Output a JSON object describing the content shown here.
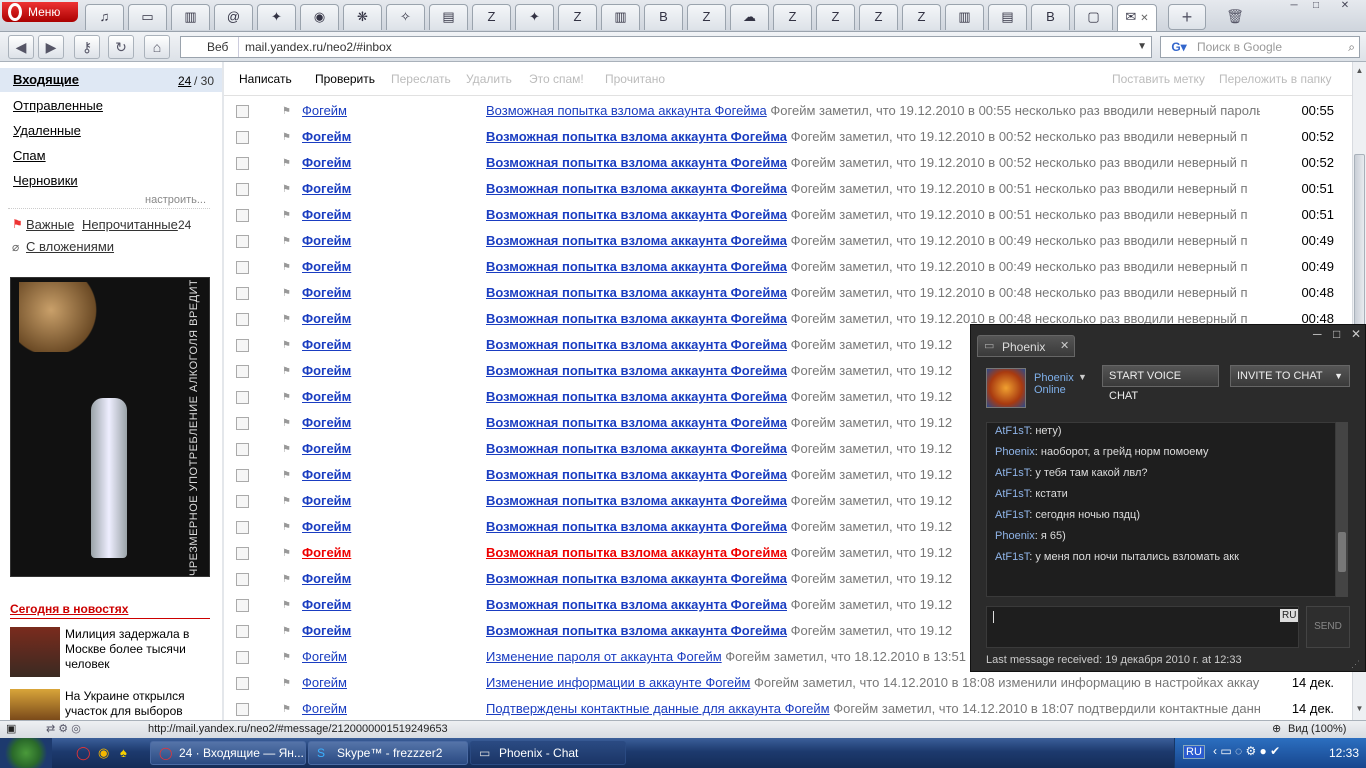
{
  "browser": {
    "menu_label": "Меню",
    "tab_icons": [
      "music-tab",
      "window-tab",
      "book-tab",
      "email-tab",
      "star-tab",
      "monitor-tab",
      "app-tab",
      "sparkle-tab",
      "doc-tab",
      "z-tab",
      "star2-tab",
      "z2-tab",
      "book2-tab",
      "b-tab",
      "z3-tab",
      "skype-tab",
      "z4-tab",
      "z5-tab",
      "z6-tab",
      "z7-tab",
      "book3-tab",
      "doc2-tab",
      "b2-tab",
      "chat-tab",
      "yandex-tab"
    ],
    "tab_glyphs": [
      "♫",
      "▭",
      "▥",
      "@",
      "✦",
      "◉",
      "❋",
      "✧",
      "▤",
      "Z",
      "✦",
      "Z",
      "▥",
      "B",
      "Z",
      "☁",
      "Z",
      "Z",
      "Z",
      "Z",
      "▥",
      "▤",
      "B",
      "▢",
      "✉"
    ],
    "address_prefix": "Веб",
    "address_url": "mail.yandex.ru/neo2/#inbox",
    "search_placeholder": "Поиск в Google"
  },
  "sidebar": {
    "inbox_label": "Входящие",
    "inbox_unread": "24",
    "inbox_total": "/ 30",
    "folders": [
      "Отправленные",
      "Удаленные",
      "Спам",
      "Черновики"
    ],
    "configure": "настроить...",
    "important": "Важные",
    "unread": "Непрочитанные",
    "unread_count": "24",
    "attachments": "С вложениями",
    "ad_text": "ЧРЕЗМЕРНОЕ УПОТРЕБЛЕНИЕ АЛКОГОЛЯ ВРЕДИТ ВАШЕМУ ЗДОРОВЬЮ",
    "news_title": "Сегодня в новостях",
    "news": [
      "Милиция задержала в Москве более тысячи человек",
      "На Украине открылся участок для выборов"
    ]
  },
  "toolbar": {
    "compose": "Написать",
    "check": "Проверить",
    "forward": "Переслать",
    "delete": "Удалить",
    "spam": "Это спам!",
    "read": "Прочитано",
    "label": "Поставить метку",
    "move": "Переложить в папку"
  },
  "emails": [
    {
      "from": "Фогейм",
      "subject": "Возможная попытка взлома аккаунта Фогейма",
      "snippet": "Фогейм заметил, что 19.12.2010 в 00:55 несколько раз вводили неверный пароль",
      "time": "00:55",
      "style": "normal"
    },
    {
      "from": "Фогейм",
      "subject": "Возможная попытка взлома аккаунта Фогейма",
      "snippet": "Фогейм заметил, что 19.12.2010 в 00:52 несколько раз вводили неверный п",
      "time": "00:52",
      "style": "bold"
    },
    {
      "from": "Фогейм",
      "subject": "Возможная попытка взлома аккаунта Фогейма",
      "snippet": "Фогейм заметил, что 19.12.2010 в 00:52 несколько раз вводили неверный п",
      "time": "00:52",
      "style": "bold"
    },
    {
      "from": "Фогейм",
      "subject": "Возможная попытка взлома аккаунта Фогейма",
      "snippet": "Фогейм заметил, что 19.12.2010 в 00:51 несколько раз вводили неверный п",
      "time": "00:51",
      "style": "bold"
    },
    {
      "from": "Фогейм",
      "subject": "Возможная попытка взлома аккаунта Фогейма",
      "snippet": "Фогейм заметил, что 19.12.2010 в 00:51 несколько раз вводили неверный п",
      "time": "00:51",
      "style": "bold"
    },
    {
      "from": "Фогейм",
      "subject": "Возможная попытка взлома аккаунта Фогейма",
      "snippet": "Фогейм заметил, что 19.12.2010 в 00:49 несколько раз вводили неверный п",
      "time": "00:49",
      "style": "bold"
    },
    {
      "from": "Фогейм",
      "subject": "Возможная попытка взлома аккаунта Фогейма",
      "snippet": "Фогейм заметил, что 19.12.2010 в 00:49 несколько раз вводили неверный п",
      "time": "00:49",
      "style": "bold"
    },
    {
      "from": "Фогейм",
      "subject": "Возможная попытка взлома аккаунта Фогейма",
      "snippet": "Фогейм заметил, что 19.12.2010 в 00:48 несколько раз вводили неверный п",
      "time": "00:48",
      "style": "bold"
    },
    {
      "from": "Фогейм",
      "subject": "Возможная попытка взлома аккаунта Фогейма",
      "snippet": "Фогейм заметил, что 19.12.2010 в 00:48 несколько раз вводили неверный п",
      "time": "00:48",
      "style": "bold"
    },
    {
      "from": "Фогейм",
      "subject": "Возможная попытка взлома аккаунта Фогейма",
      "snippet": "Фогейм заметил, что 19.12",
      "time": "",
      "style": "bold"
    },
    {
      "from": "Фогейм",
      "subject": "Возможная попытка взлома аккаунта Фогейма",
      "snippet": "Фогейм заметил, что 19.12",
      "time": "",
      "style": "bold"
    },
    {
      "from": "Фогейм",
      "subject": "Возможная попытка взлома аккаунта Фогейма",
      "snippet": "Фогейм заметил, что 19.12",
      "time": "",
      "style": "bold"
    },
    {
      "from": "Фогейм",
      "subject": "Возможная попытка взлома аккаунта Фогейма",
      "snippet": "Фогейм заметил, что 19.12",
      "time": "",
      "style": "bold"
    },
    {
      "from": "Фогейм",
      "subject": "Возможная попытка взлома аккаунта Фогейма",
      "snippet": "Фогейм заметил, что 19.12",
      "time": "",
      "style": "bold"
    },
    {
      "from": "Фогейм",
      "subject": "Возможная попытка взлома аккаунта Фогейма",
      "snippet": "Фогейм заметил, что 19.12",
      "time": "",
      "style": "bold"
    },
    {
      "from": "Фогейм",
      "subject": "Возможная попытка взлома аккаунта Фогейма",
      "snippet": "Фогейм заметил, что 19.12",
      "time": "",
      "style": "bold"
    },
    {
      "from": "Фогейм",
      "subject": "Возможная попытка взлома аккаунта Фогейма",
      "snippet": "Фогейм заметил, что 19.12",
      "time": "",
      "style": "bold"
    },
    {
      "from": "Фогейм",
      "subject": "Возможная попытка взлома аккаунта Фогейма",
      "snippet": "Фогейм заметил, что 19.12",
      "time": "",
      "style": "red"
    },
    {
      "from": "Фогейм",
      "subject": "Возможная попытка взлома аккаунта Фогейма",
      "snippet": "Фогейм заметил, что 19.12",
      "time": "",
      "style": "bold"
    },
    {
      "from": "Фогейм",
      "subject": "Возможная попытка взлома аккаунта Фогейма",
      "snippet": "Фогейм заметил, что 19.12",
      "time": "",
      "style": "bold"
    },
    {
      "from": "Фогейм",
      "subject": "Возможная попытка взлома аккаунта Фогейма",
      "snippet": "Фогейм заметил, что 19.12",
      "time": "",
      "style": "bold"
    },
    {
      "from": "Фогейм",
      "subject": "Изменение пароля от аккаунта Фогейм",
      "snippet": "Фогейм заметил, что 18.12.2010 в 13:51",
      "time": "",
      "style": "normal"
    },
    {
      "from": "Фогейм",
      "subject": "Изменение информации в аккаунте Фогейм",
      "snippet": "Фогейм заметил, что 14.12.2010 в 18:08 изменили информацию в настройках аккаун",
      "time": "14 дек.",
      "style": "normal"
    },
    {
      "from": "Фогейм",
      "subject": "Подтверждены контактные данные для аккаунта Фогейм",
      "snippet": "Фогейм заметил, что 14.12.2010 в 18:07 подтвердили контактные данн",
      "time": "14 дек.",
      "style": "normal"
    }
  ],
  "status": {
    "url": "http://mail.yandex.ru/neo2/#message/2120000001519249653",
    "zoom": "Вид (100%)"
  },
  "chat": {
    "title": "Phoenix",
    "user": "Phoenix",
    "presence": "Online",
    "voice": "START VOICE CHAT",
    "invite": "INVITE TO CHAT",
    "messages": [
      {
        "who": "AtF1sT",
        "text": ": нету)"
      },
      {
        "who": "Phoenix",
        "text": ": наоборот, а грейд норм помоему"
      },
      {
        "who": "AtF1sT",
        "text": ": у тебя там какой лвл?"
      },
      {
        "who": "AtF1sT",
        "text": ": кстати"
      },
      {
        "who": "AtF1sT",
        "text": ": сегодня ночью пздц)"
      },
      {
        "who": "Phoenix",
        "text": ": я 65)"
      },
      {
        "who": "AtF1sT",
        "text": ": у меня пол ночи пытались взломать акк"
      }
    ],
    "lang": "RU",
    "send": "SEND",
    "last": "Last message received: 19 декабря 2010 г. at 12:33"
  },
  "taskbar": {
    "items": [
      "24 · Входящие — Ян...",
      "Skype™ - frezzzer2",
      "Phoenix - Chat"
    ],
    "lang": "RU",
    "clock": "12:33"
  }
}
